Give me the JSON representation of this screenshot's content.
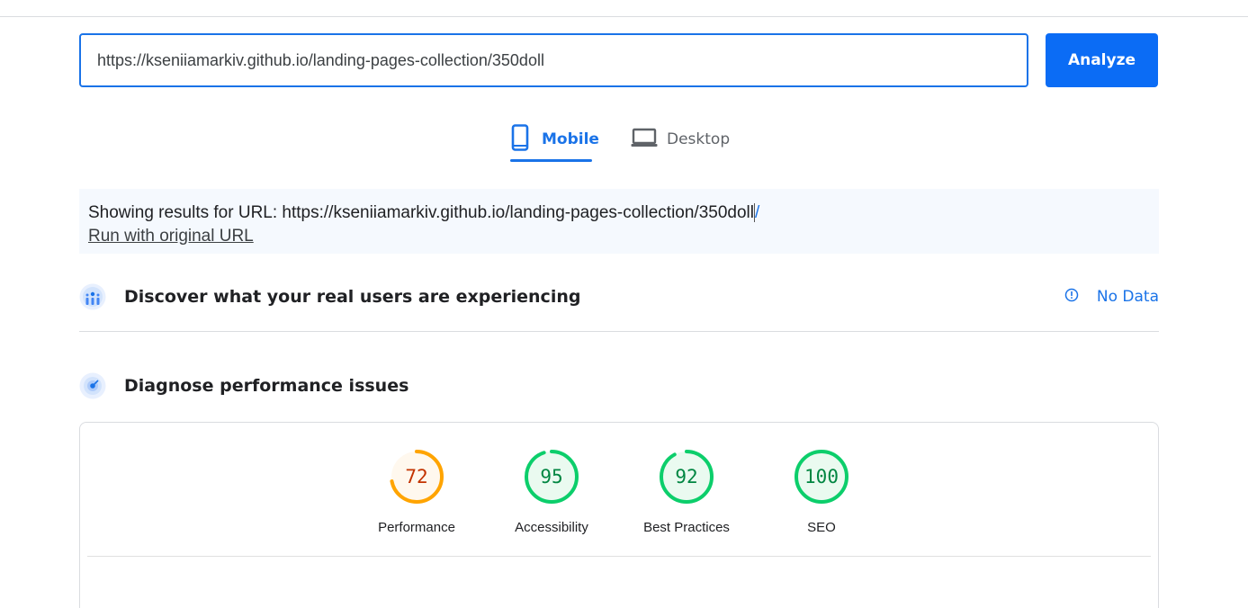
{
  "url_input": {
    "value": "https://kseniiamarkiv.github.io/landing-pages-collection/350doll"
  },
  "analyze_button": {
    "label": "Analyze"
  },
  "tabs": [
    {
      "label": "Mobile",
      "icon": "smartphone-icon",
      "active": true
    },
    {
      "label": "Desktop",
      "icon": "laptop-icon",
      "active": false
    }
  ],
  "results": {
    "prefix": "Showing results for URL: https://kseniiamarkiv.github.io/landing-pages-collection/350doll",
    "suffix": "/",
    "run_link": "Run with original URL"
  },
  "field_data": {
    "title": "Discover what your real users are experiencing",
    "status": "No Data",
    "icon": "crux-users-icon",
    "status_icon": "info-icon"
  },
  "lab_data": {
    "title": "Diagnose performance issues",
    "icon": "lighthouse-icon"
  },
  "scores": [
    {
      "label": "Performance",
      "value": 72,
      "color": "#ffa400",
      "fill": "#fff8ee",
      "text_color": "#c33300"
    },
    {
      "label": "Accessibility",
      "value": 95,
      "color": "#0cce6b",
      "fill": "#eafaf0",
      "text_color": "#018642"
    },
    {
      "label": "Best Practices",
      "value": 92,
      "color": "#0cce6b",
      "fill": "#eafaf0",
      "text_color": "#018642"
    },
    {
      "label": "SEO",
      "value": 100,
      "color": "#0cce6b",
      "fill": "#eafaf0",
      "text_color": "#018642"
    }
  ],
  "colors": {
    "accent": "#1a73e8",
    "button": "#0b6cf5"
  }
}
